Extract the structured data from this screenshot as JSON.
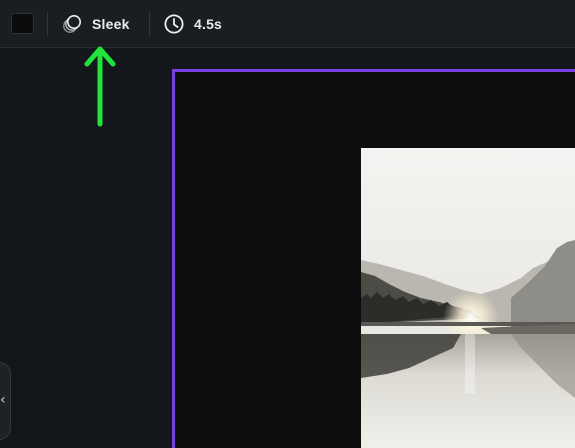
{
  "toolbar": {
    "swatch_color": "#0c0c0c",
    "style_tool": {
      "icon": "style-layers-icon",
      "label": "Sleek"
    },
    "duration_tool": {
      "icon": "clock-icon",
      "label": "4.5s"
    }
  },
  "annotation": {
    "arrow_color": "#22e33b",
    "icon": "up-arrow-icon"
  },
  "canvas": {
    "frame_color": "#7a3fe0",
    "background": "#0d0d0d",
    "image": "lake-mountain-sunrise-photo"
  },
  "sidebar": {
    "collapse_icon": "chevron-left-icon",
    "collapse_glyph": "‹"
  }
}
